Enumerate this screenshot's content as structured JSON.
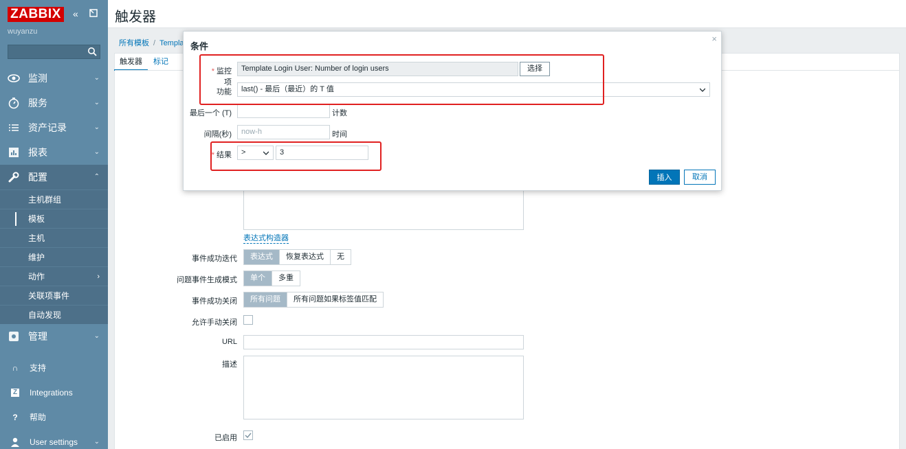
{
  "sidebar": {
    "logo": "ZABBIX",
    "server_name": "wuyanzu",
    "search_placeholder": "",
    "menu": [
      {
        "label": "监测",
        "icon": "eye-icon"
      },
      {
        "label": "服务",
        "icon": "clock-icon"
      },
      {
        "label": "资产记录",
        "icon": "list-icon"
      },
      {
        "label": "报表",
        "icon": "chart-icon"
      },
      {
        "label": "配置",
        "icon": "wrench-icon"
      }
    ],
    "submenu": [
      "主机群组",
      "模板",
      "主机",
      "维护",
      "动作",
      "关联项事件",
      "自动发现"
    ],
    "admin": {
      "label": "管理",
      "icon": "gear-icon"
    },
    "bottom": [
      {
        "label": "支持",
        "icon": "headset-icon"
      },
      {
        "label": "Integrations",
        "icon": "zabbix-icon"
      },
      {
        "label": "帮助",
        "icon": "help-icon"
      },
      {
        "label": "User settings",
        "icon": "user-icon"
      }
    ]
  },
  "header": {
    "title": "触发器"
  },
  "breadcrumb": [
    "所有模板",
    "Templa"
  ],
  "tabs": [
    "触发器",
    "标记"
  ],
  "form": {
    "expression_builder_link": "表达式构造器",
    "ok_event_generation": {
      "label": "事件成功迭代",
      "options": [
        "表达式",
        "恢复表达式",
        "无"
      ],
      "selected": "表达式"
    },
    "problem_event_mode": {
      "label": "问题事件生成模式",
      "options": [
        "单个",
        "多重"
      ],
      "selected": "单个"
    },
    "ok_event_closes": {
      "label": "事件成功关闭",
      "options": [
        "所有问题",
        "所有问题如果标签值匹配"
      ],
      "selected": "所有问题"
    },
    "allow_manual_close": {
      "label": "允许手动关闭",
      "checked": false
    },
    "url": {
      "label": "URL",
      "value": ""
    },
    "description": {
      "label": "描述",
      "value": ""
    },
    "enabled": {
      "label": "已启用",
      "checked": true
    }
  },
  "modal": {
    "title": "条件",
    "close_symbol": "×",
    "item_label": "监控项",
    "item_value": "Template Login User: Number of login users",
    "select_button": "选择",
    "function_label": "功能",
    "function_value": "last() - 最后（最近）的 T 值",
    "last_t_label": "最后一个 (T)",
    "last_t_value": "",
    "last_t_suffix": "计数",
    "interval_label": "间隔(秒)",
    "interval_placeholder": "now-h",
    "interval_suffix": "时间",
    "result_label": "结果",
    "result_operator": ">",
    "result_value": "3",
    "insert_button": "插入",
    "cancel_button": "取消",
    "required_mark": "*"
  }
}
